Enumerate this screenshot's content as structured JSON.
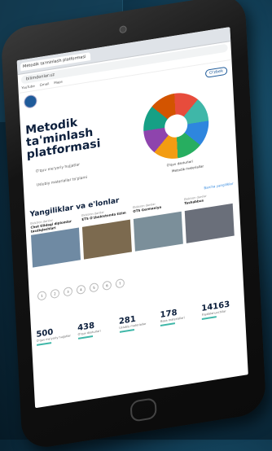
{
  "browser": {
    "tab_title": "Metodik ta'minlash platformasi",
    "url": "bilimdonlar.uz",
    "bookmarks": [
      "YouTube",
      "Gmail",
      "Maps"
    ]
  },
  "header": {
    "org_text": "",
    "lang_button": "O'zbek"
  },
  "hero": {
    "title": "Metodik ta'minlash platformasi",
    "link1": "O'quv me'yoriy hujjatlar",
    "link2": "Uslubiy materiallar to'plami",
    "caption1": "O'quv dasturlari",
    "caption2": "Metodik materiallar"
  },
  "news": {
    "title": "Yangiliklar va e'lonlar",
    "view_all": "Barcha yangiliklar",
    "cards": [
      {
        "tag": "Elektron darslar",
        "title": "Chet tilidagi diplomlar tasdiqlashlari",
        "text": "",
        "color": "#6f8aa3"
      },
      {
        "tag": "Elektron darslar",
        "title": "ETS O'zbekistonda tizim",
        "text": "",
        "color": "#7c6a4f"
      },
      {
        "tag": "Elektron darslar",
        "title": "OTS Germaniya",
        "text": "",
        "color": "#7b8f9a"
      },
      {
        "tag": "Elektron darslar",
        "title": "Tashabbus",
        "text": "",
        "color": "#6a6f7a"
      }
    ]
  },
  "pager": {
    "pages": [
      "1",
      "2",
      "3",
      "4",
      "5",
      "6",
      "7"
    ]
  },
  "stats": [
    {
      "num": "500",
      "label": "O'quv me'yoriy hujjatlar"
    },
    {
      "num": "438",
      "label": "O'quv dasturlari"
    },
    {
      "num": "281",
      "label": "Uslubiy materiallar"
    },
    {
      "num": "178",
      "label": "Baza materiallari"
    },
    {
      "num": "14163",
      "label": "Foydalanuvchilar"
    }
  ],
  "colors": {
    "accent": "#3fb7a8",
    "brand": "#1f5b9a",
    "title": "#0c1f3c"
  }
}
